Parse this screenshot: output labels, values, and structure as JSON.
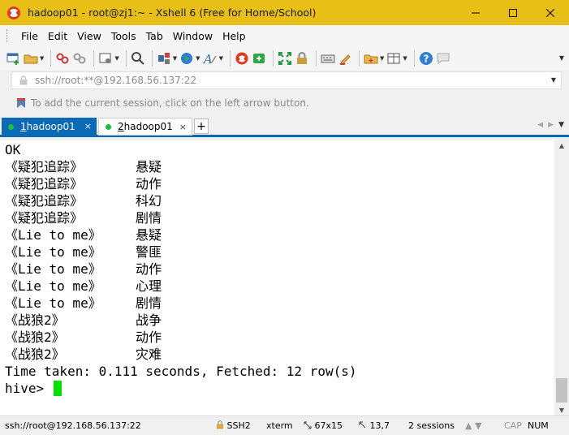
{
  "window": {
    "title": "hadoop01 - root@zj1:~ - Xshell 6 (Free for Home/School)"
  },
  "menu": [
    "File",
    "Edit",
    "View",
    "Tools",
    "Tab",
    "Window",
    "Help"
  ],
  "address": {
    "value": "ssh://root:**@192.168.56.137:22"
  },
  "hint": {
    "text": "To add the current session, click on the left arrow button."
  },
  "tabs": [
    {
      "num": "1",
      "label": " hadoop01",
      "active": true
    },
    {
      "num": "2",
      "label": " hadoop01",
      "active": false
    }
  ],
  "terminal": {
    "header": "OK",
    "rows": [
      {
        "movie": "《疑犯追踪》",
        "genre": "悬疑"
      },
      {
        "movie": "《疑犯追踪》",
        "genre": "动作"
      },
      {
        "movie": "《疑犯追踪》",
        "genre": "科幻"
      },
      {
        "movie": "《疑犯追踪》",
        "genre": "剧情"
      },
      {
        "movie": "《Lie to me》",
        "genre": "悬疑"
      },
      {
        "movie": "《Lie to me》",
        "genre": "警匪"
      },
      {
        "movie": "《Lie to me》",
        "genre": "动作"
      },
      {
        "movie": "《Lie to me》",
        "genre": "心理"
      },
      {
        "movie": "《Lie to me》",
        "genre": "剧情"
      },
      {
        "movie": "《战狼2》",
        "genre": "战争"
      },
      {
        "movie": "《战狼2》",
        "genre": "动作"
      },
      {
        "movie": "《战狼2》",
        "genre": "灾难"
      }
    ],
    "summary": "Time taken: 0.111 seconds, Fetched: 12 row(s)",
    "prompt": "hive> "
  },
  "status": {
    "connection": "ssh://root@192.168.56.137:22",
    "protocol": "SSH2",
    "terminal_type": "xterm",
    "size": "67x15",
    "cursor_pos": "13,7",
    "sessions": "2 sessions",
    "caps": "CAP",
    "num": "NUM"
  },
  "colors": {
    "titlebar": "#e8bf16",
    "tab_active": "#0a6ab5",
    "cursor": "#00e000",
    "session_dot": "#1dbf3c"
  }
}
